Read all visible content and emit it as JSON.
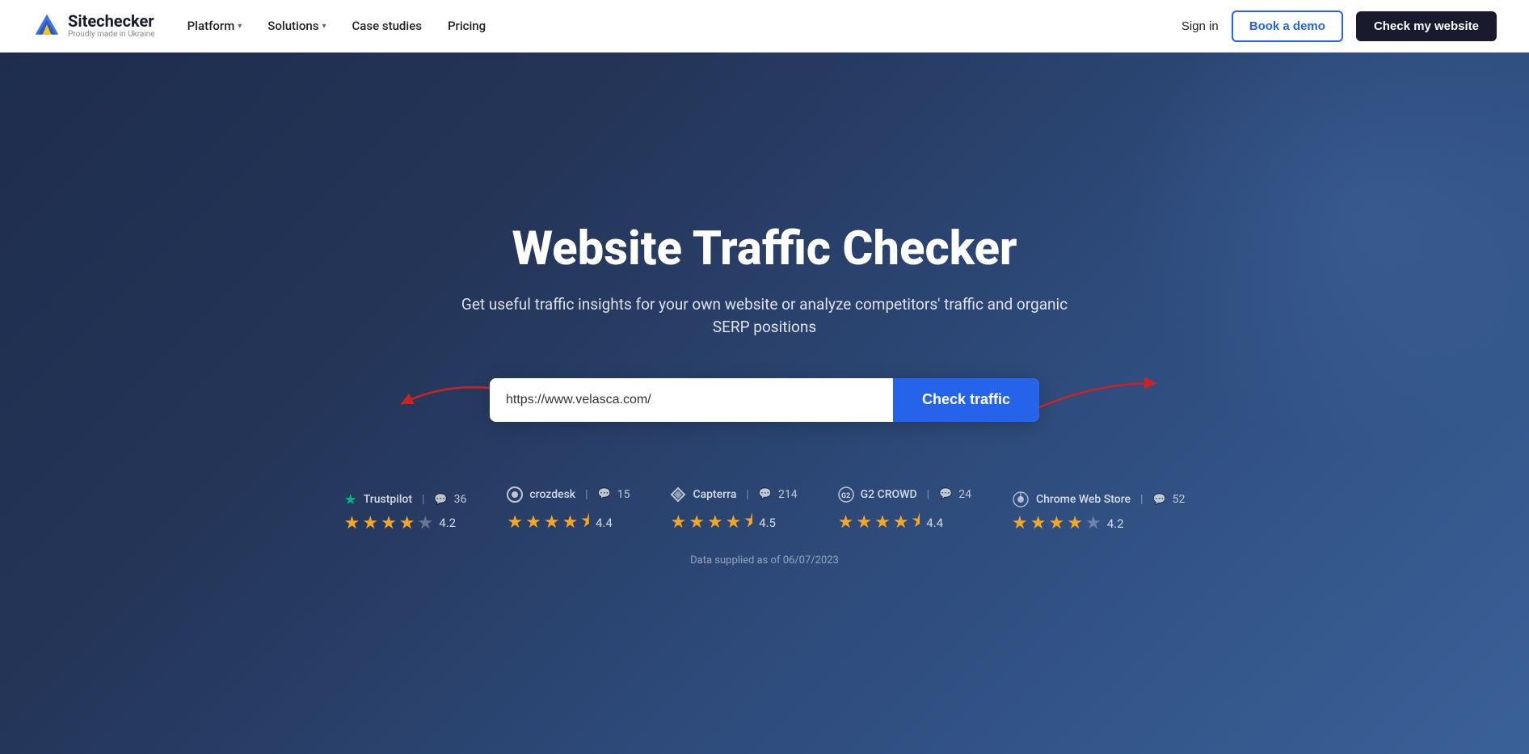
{
  "navbar": {
    "logo_name": "Sitechecker",
    "logo_tagline": "Proudly made in Ukraine",
    "nav_items": [
      {
        "label": "Platform",
        "has_dropdown": true
      },
      {
        "label": "Solutions",
        "has_dropdown": true
      },
      {
        "label": "Case studies",
        "has_dropdown": false
      },
      {
        "label": "Pricing",
        "has_dropdown": false
      }
    ],
    "sign_in_label": "Sign in",
    "book_demo_label": "Book a demo",
    "check_website_label": "Check my website"
  },
  "hero": {
    "title": "Website Traffic Checker",
    "subtitle": "Get useful traffic insights for your own website or analyze competitors' traffic and organic SERP positions",
    "input_placeholder": "https://www.velasca.com/",
    "input_value": "https://www.velasca.com/",
    "check_traffic_label": "Check traffic"
  },
  "ratings": [
    {
      "name": "Trustpilot",
      "icon": "star",
      "count": "36",
      "stars": [
        1,
        1,
        1,
        1,
        0
      ],
      "half_at": null,
      "score": "4.2"
    },
    {
      "name": "crozdesk",
      "icon": "circle-c",
      "count": "15",
      "stars": [
        1,
        1,
        1,
        1,
        0.5
      ],
      "half_at": 4,
      "score": "4.4"
    },
    {
      "name": "Capterra",
      "icon": "arrow-capterra",
      "count": "214",
      "stars": [
        1,
        1,
        1,
        1,
        0.5
      ],
      "half_at": 4,
      "score": "4.5"
    },
    {
      "name": "G2 CROWD",
      "icon": "g2",
      "count": "24",
      "stars": [
        1,
        1,
        1,
        1,
        0.5
      ],
      "half_at": 4,
      "score": "4.4"
    },
    {
      "name": "Chrome Web Store",
      "icon": "chrome",
      "count": "52",
      "stars": [
        1,
        1,
        1,
        1,
        0
      ],
      "half_at": null,
      "score": "4.2"
    }
  ],
  "data_supplied": "Data supplied as of 06/07/2023"
}
